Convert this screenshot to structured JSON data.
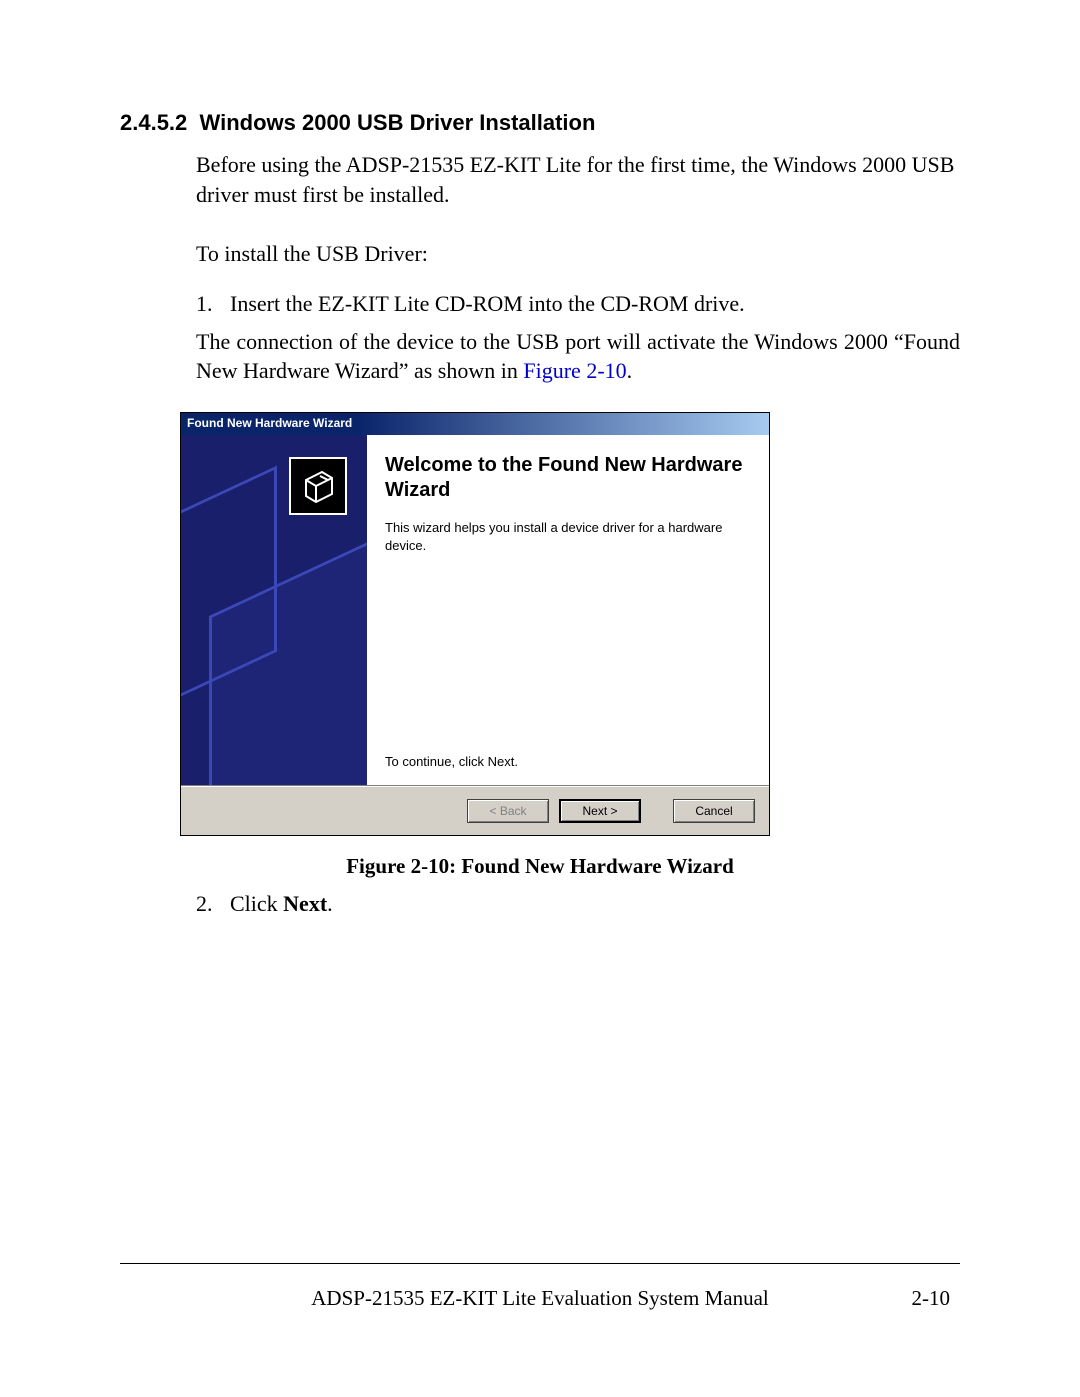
{
  "section": {
    "number": "2.4.5.2",
    "title": "Windows 2000 USB Driver Installation"
  },
  "paragraphs": {
    "intro": "Before using the ADSP-21535 EZ-KIT Lite for the first time, the Windows 2000 USB driver must first be installed.",
    "lead": "To install the USB Driver:",
    "connection_pre": "The connection of the device to the USB port will activate the Windows 2000 “Found New Hardware Wizard” as shown in ",
    "connection_link": "Figure 2-10",
    "connection_post": "."
  },
  "steps": [
    {
      "num": "1.",
      "text": "Insert the EZ-KIT Lite CD-ROM into the CD-ROM drive."
    },
    {
      "num": "2.",
      "text_pre": "Click ",
      "bold": "Next",
      "text_post": "."
    }
  ],
  "wizard": {
    "titlebar": "Found New Hardware Wizard",
    "heading": "Welcome to the Found New Hardware Wizard",
    "description": "This wizard helps you install a device driver for a hardware device.",
    "continue": "To continue, click Next.",
    "buttons": {
      "back": "< Back",
      "next": "Next >",
      "cancel": "Cancel"
    }
  },
  "figure_caption": "Figure 2-10: Found New Hardware Wizard",
  "footer": {
    "title": "ADSP-21535 EZ-KIT Lite Evaluation System Manual",
    "page": "2-10"
  }
}
